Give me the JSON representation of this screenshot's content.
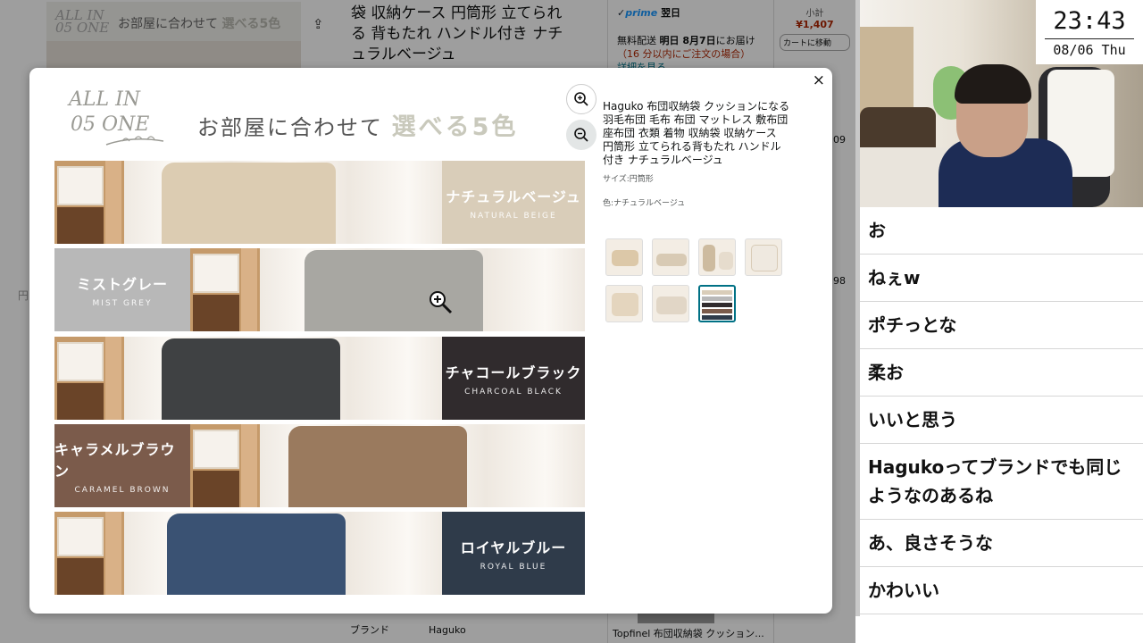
{
  "background_page": {
    "thumb_logo": "ALL IN\n05 ONE",
    "thumb_text": "お部屋に合わせて",
    "thumb_accent": "選べる5色",
    "title_line1": "袋 収納ケース 円筒形 立てられ",
    "title_line2": "る 背もたれ ハンドル付き ナチ",
    "title_line3": "ュラルベージュ",
    "prime_label": "prime",
    "prime_day": "翌日",
    "delivery_line1": "無料配送",
    "delivery_bold": "明日 8月7日",
    "delivery_suffix": "にお届け",
    "delivery_red": "（16 分以内にご注文の場合）",
    "delivery_more": "詳細を見る",
    "subtotal_label": "小計",
    "subtotal_price": "¥1,407",
    "cart_button": "カートに移動",
    "side_number_1": "09",
    "side_number_2": "98",
    "brand_label": "ブランド",
    "brand_value": "Haguko",
    "bottom_product": "Topfinel 布団収納袋 クッション..."
  },
  "modal": {
    "close_label": "×",
    "logo_line1": "ALL IN",
    "logo_line2": "05 ONE",
    "headline": "お部屋に合わせて",
    "headline_accent": "選べる5色",
    "product_title": "Haguko 布団収納袋 クッションになる 羽毛布団 毛布 布団 マットレス 敷布団 座布団 衣類 着物 収納袋 収納ケース 円筒形 立てられる背もたれ ハンドル付き ナチュラルベージュ",
    "size_label": "サイズ:円筒形",
    "color_label": "色:ナチュラルベージュ",
    "colors": [
      {
        "jp": "ナチュラルベージュ",
        "en": "NATURAL BEIGE",
        "swatch": "#d9cdb9",
        "pillow": "#dcccb2"
      },
      {
        "jp": "ミストグレー",
        "en": "MIST GREY",
        "swatch": "#b8b8b8",
        "pillow": "#a8a7a2"
      },
      {
        "jp": "チャコールブラック",
        "en": "CHARCOAL BLACK",
        "swatch": "#302b2d",
        "pillow": "#3f4143"
      },
      {
        "jp": "キャラメルブラウン",
        "en": "CARAMEL BROWN",
        "swatch": "#7b5b4b",
        "pillow": "#9a7a5e"
      },
      {
        "jp": "ロイヤルブルー",
        "en": "ROYAL BLUE",
        "swatch": "#2f3b4a",
        "pillow": "#3a5273"
      }
    ],
    "thumbnail_count": 7,
    "selected_thumbnail": 7
  },
  "stream": {
    "clock_time": "23:43",
    "clock_date": "08/06 Thu",
    "chat": [
      "お",
      "ねぇw",
      "ポチっとな",
      "柔お",
      "いいと思う",
      "Hagukoってブランドでも同じようなのあるね",
      "あ、良さそうな",
      "かわいい"
    ]
  }
}
